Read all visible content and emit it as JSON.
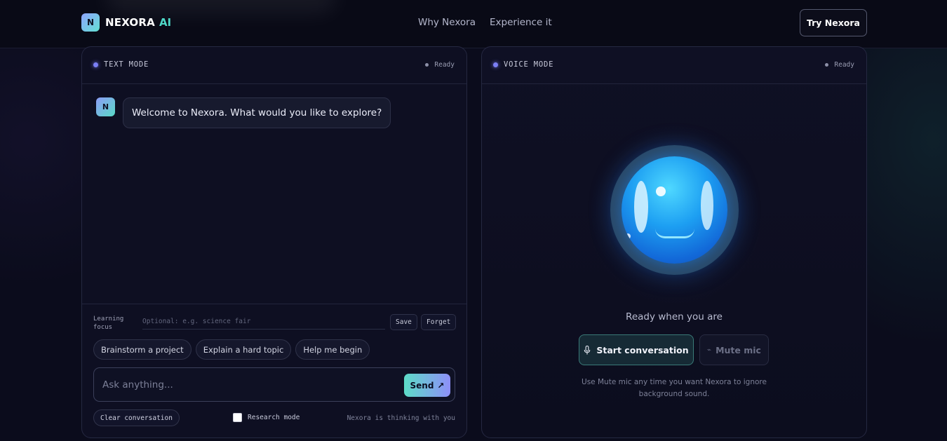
{
  "header": {
    "logo_letter": "N",
    "brand": "NEXORA",
    "brand_suffix": "AI",
    "nav": [
      "Why Nexora",
      "Experience it"
    ],
    "cta": "Try Nexora"
  },
  "text_panel": {
    "mode_label": "TEXT MODE",
    "status": "Ready",
    "messages": [
      {
        "avatar": "N",
        "text": "Welcome to Nexora. What would you like to explore?"
      }
    ],
    "focus_label": "Learning focus",
    "focus_placeholder": "Optional: e.g. science fair",
    "save_label": "Save",
    "forget_label": "Forget",
    "chips": [
      "Brainstorm a project",
      "Explain a hard topic",
      "Help me begin"
    ],
    "ask_placeholder": "Ask anything...",
    "send_label": "Send",
    "send_icon": "↗",
    "clear_label": "Clear conversation",
    "research_label": "Research mode",
    "thinking_text": "Nexora is thinking with you"
  },
  "voice_panel": {
    "mode_label": "VOICE MODE",
    "status": "Ready",
    "ready_text": "Ready when you are",
    "start_label": "Start conversation",
    "mute_label": "Mute mic",
    "hint": "Use Mute mic any time you want Nexora to ignore background sound."
  },
  "colors": {
    "accent": "#7b7ff5",
    "teal": "#4fd8c8",
    "background": "#0b0c1c"
  }
}
